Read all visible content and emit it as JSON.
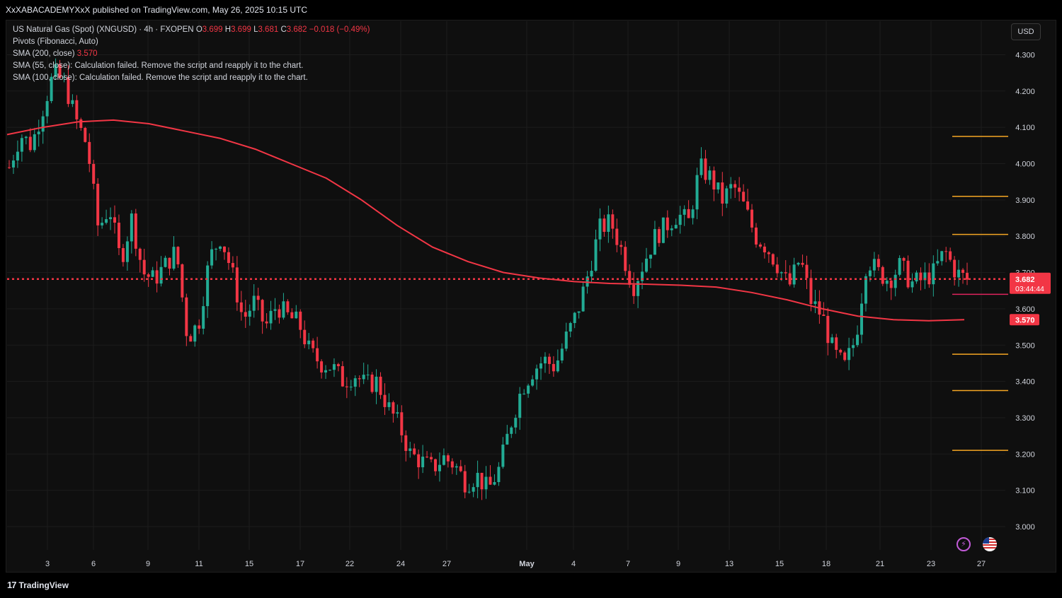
{
  "header": {
    "published_line": "XxXABACADEMYXxX published on TradingView.com, May 26, 2025 10:15 UTC"
  },
  "legend": {
    "symbol": "US Natural Gas (Spot) (XNGUSD) · 4h · FXOPEN",
    "ohlc": {
      "o_label": "O",
      "o": "3.699",
      "h_label": "H",
      "h": "3.699",
      "l_label": "L",
      "l": "3.681",
      "c_label": "C",
      "c": "3.682",
      "change": "−0.018 (−0.49%)"
    },
    "pivots": "Pivots (Fibonacci, Auto)",
    "sma200_label": "SMA (200, close)",
    "sma200_value": "3.570",
    "sma55_msg": "SMA (55, close): Calculation failed. Remove the script and reapply it to the chart.",
    "sma100_msg": "SMA (100, close): Calculation failed. Remove the script and reapply it to the chart."
  },
  "currency": "USD",
  "footer": {
    "brand": "TradingView",
    "brand_mark": "17"
  },
  "icons": {
    "bolt": "lightning-icon",
    "flag": "us-flag-icon"
  },
  "colors": {
    "up": "#22ab94",
    "down": "#f23645",
    "sma": "#f23645",
    "pivot": "#f5a623",
    "price_line": "#f23645",
    "grid": "#1c1c1c",
    "axis_text": "#d1d4dc"
  },
  "chart_data": {
    "type": "candlestick",
    "title": "US Natural Gas (Spot) (XNGUSD)",
    "interval": "4h",
    "ylim": [
      2.95,
      4.35
    ],
    "y_ticks": [
      3.0,
      3.1,
      3.2,
      3.3,
      3.4,
      3.5,
      3.6,
      3.7,
      3.8,
      3.9,
      4.0,
      4.1,
      4.2,
      4.3
    ],
    "y_tick_labels": [
      "3.000",
      "3.100",
      "3.200",
      "3.300",
      "3.400",
      "3.500",
      "3.600",
      "3.700",
      "3.800",
      "3.900",
      "4.000",
      "4.100",
      "4.200",
      "4.300"
    ],
    "x_ticks": [
      "3",
      "6",
      "9",
      "11",
      "15",
      "17",
      "22",
      "24",
      "27",
      "May",
      "4",
      "7",
      "9",
      "13",
      "15",
      "18",
      "21",
      "23",
      "27"
    ],
    "last_price": "3.682",
    "countdown": "03:44:44",
    "sma200_last": "3.570",
    "pivot_levels": [
      3.21,
      3.375,
      3.475,
      3.64,
      3.805,
      3.91,
      4.075
    ],
    "close_path": [
      3.99,
      4.08,
      4.05,
      4.15,
      4.25,
      4.22,
      4.12,
      4.05,
      3.82,
      3.88,
      3.73,
      3.85,
      3.7,
      3.68,
      3.72,
      3.76,
      3.52,
      3.56,
      3.74,
      3.8,
      3.7,
      3.57,
      3.62,
      3.55,
      3.61,
      3.58,
      3.56,
      3.48,
      3.45,
      3.44,
      3.4,
      3.42,
      3.39,
      3.4,
      3.33,
      3.28,
      3.2,
      3.18,
      3.16,
      3.19,
      3.17,
      3.12,
      3.14,
      3.1,
      3.16,
      3.28,
      3.38,
      3.43,
      3.46,
      3.44,
      3.52,
      3.59,
      3.7,
      3.82,
      3.84,
      3.76,
      3.66,
      3.73,
      3.8,
      3.83,
      3.86,
      3.84,
      3.99,
      3.96,
      3.9,
      3.94,
      3.88,
      3.8,
      3.77,
      3.72,
      3.66,
      3.74,
      3.62,
      3.58,
      3.48,
      3.44,
      3.52,
      3.74,
      3.7,
      3.68,
      3.72,
      3.67,
      3.68,
      3.7,
      3.76,
      3.7,
      3.68
    ],
    "sma200": [
      4.08,
      4.1,
      4.115,
      4.12,
      4.11,
      4.09,
      4.07,
      4.04,
      4.0,
      3.96,
      3.9,
      3.83,
      3.77,
      3.73,
      3.7,
      3.685,
      3.675,
      3.67,
      3.668,
      3.665,
      3.66,
      3.645,
      3.625,
      3.6,
      3.58,
      3.57,
      3.567,
      3.57
    ]
  }
}
